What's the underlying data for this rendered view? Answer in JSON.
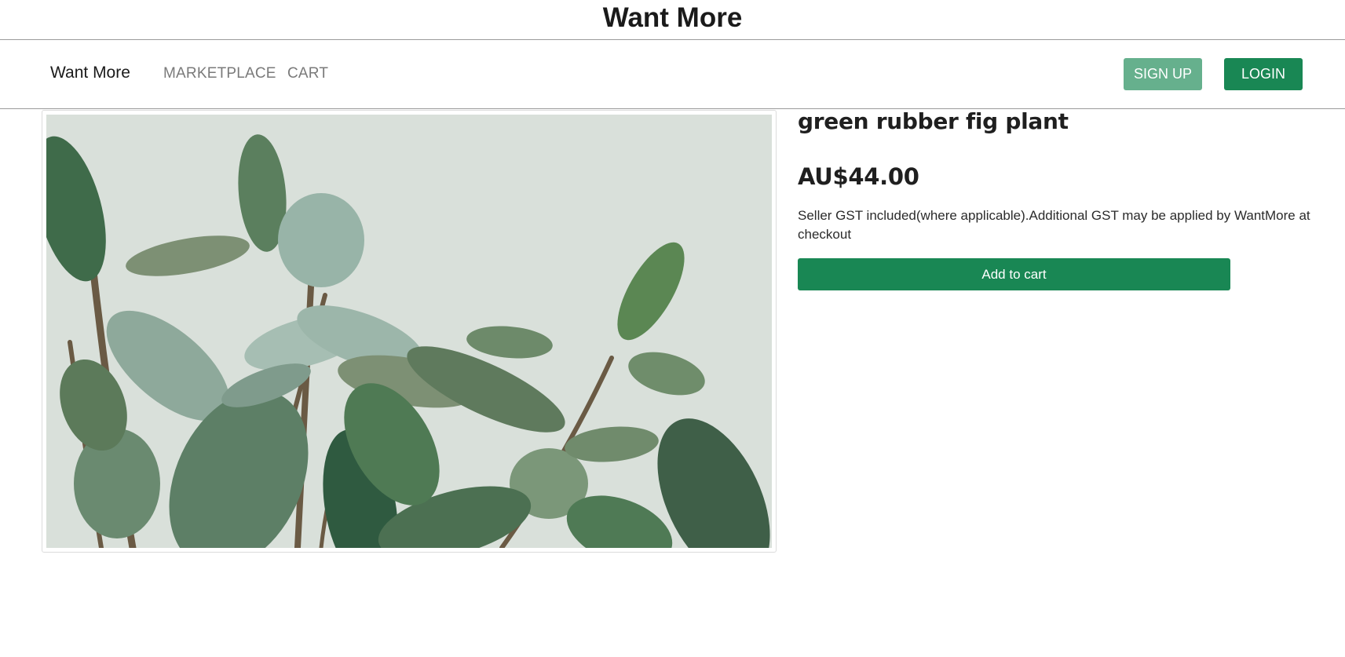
{
  "banner": {
    "title": "Want More"
  },
  "navbar": {
    "brand": "Want More",
    "links": [
      {
        "label": "MARKETPLACE"
      },
      {
        "label": "CART"
      }
    ],
    "signup_label": "SIGN UP",
    "login_label": "LOGIN"
  },
  "product": {
    "title": "green rubber fig plant",
    "price": "AU$44.00",
    "gst_note": "Seller GST included(where applicable).Additional GST may be applied by WantMore at checkout",
    "add_to_cart_label": "Add to cart",
    "image_alt": "green rubber fig plant photo"
  },
  "colors": {
    "primary": "#198754",
    "primary_light": "#66b08d",
    "nav_link": "#7a7a7a",
    "border": "#9a9a9a"
  }
}
